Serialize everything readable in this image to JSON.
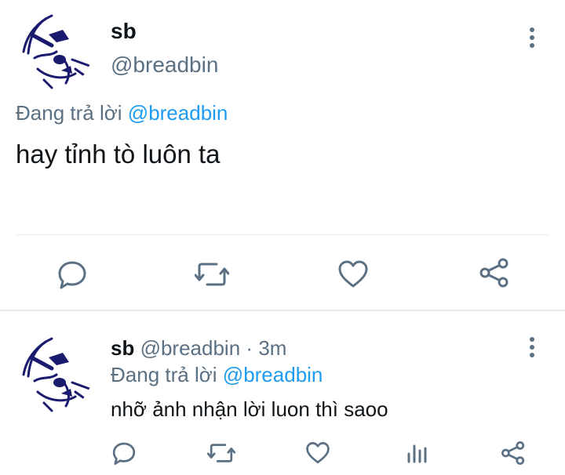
{
  "main_tweet": {
    "display_name": "sb",
    "handle": "@breadbin",
    "reply_prefix": "Đang trả lời",
    "reply_handle": "@breadbin",
    "text": "hay tỉnh tò luôn ta",
    "avatar_icon": "sketch-face-avatar",
    "more_icon": "more-vertical-icon",
    "actions": [
      "reply-icon",
      "retweet-icon",
      "like-icon",
      "share-icon"
    ]
  },
  "reply_tweet": {
    "display_name": "sb",
    "handle": "@breadbin",
    "separator": "·",
    "time": "3m",
    "reply_prefix": "Đang trả lời",
    "reply_handle": "@breadbin",
    "text": "nhỡ ảnh nhận lời luon thì saoo",
    "avatar_icon": "sketch-face-avatar",
    "more_icon": "more-vertical-icon",
    "actions": [
      "reply-icon",
      "retweet-icon",
      "like-icon",
      "analytics-icon",
      "share-icon"
    ]
  },
  "colors": {
    "text": "#0f1419",
    "muted": "#5b7083",
    "link": "#1d9bf0",
    "divider": "#e6ecf0",
    "avatar_ink": "#1a1a6e"
  }
}
